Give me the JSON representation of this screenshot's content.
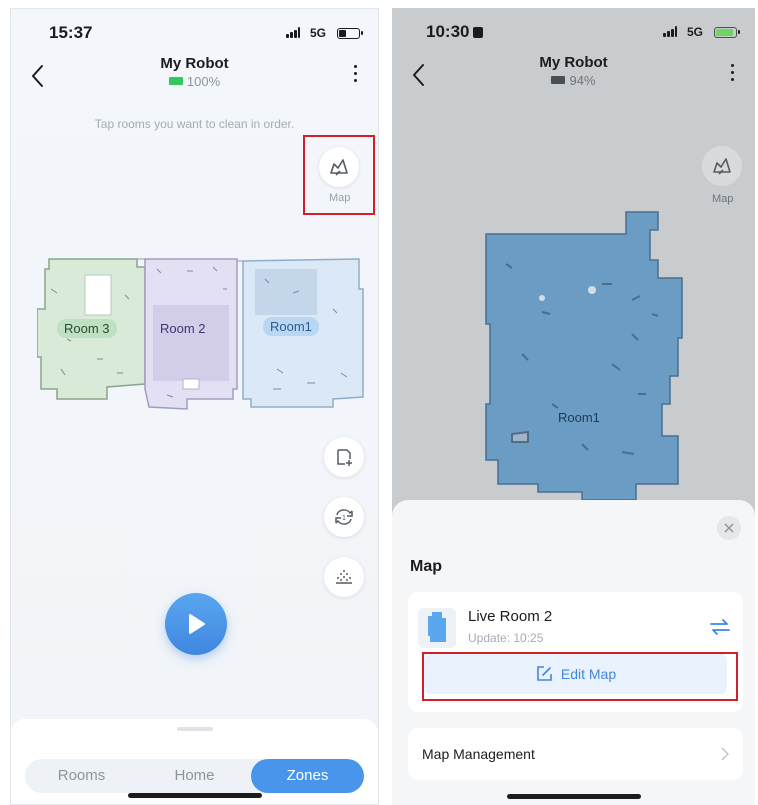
{
  "left": {
    "status": {
      "time": "15:37",
      "network": "5G"
    },
    "header": {
      "title": "My Robot",
      "battery": "100%"
    },
    "hint": "Tap rooms you want to clean in order.",
    "map_button_label": "Map",
    "rooms": [
      {
        "label": "Room 3"
      },
      {
        "label": "Room 2"
      },
      {
        "label": "Room1"
      }
    ],
    "modes": [
      {
        "label": "Rooms"
      },
      {
        "label": "Home"
      },
      {
        "label": "Zones",
        "selected": true
      }
    ],
    "icons": [
      "back-arrow-icon",
      "more-icon",
      "map-switch-icon",
      "add-zone-icon",
      "repeat-once-icon",
      "suction-icon",
      "play-icon"
    ]
  },
  "right": {
    "status": {
      "time": "10:30",
      "network": "5G",
      "charging": true
    },
    "header": {
      "title": "My Robot",
      "battery": "94%"
    },
    "map_button_label": "Map",
    "room_label": "Room1",
    "sheet": {
      "title": "Map",
      "live_map_name": "Live Room 2",
      "update_text": "Update: 10:25",
      "edit_button": "Edit Map",
      "management_label": "Map Management"
    },
    "icons": [
      "back-arrow-icon",
      "more-icon",
      "map-switch-icon",
      "close-icon",
      "swap-icon",
      "edit-icon",
      "chevron-right-icon"
    ]
  },
  "colors": {
    "accent": "#4a95ec",
    "highlight": "#d0202a",
    "battery_full": "#34c759",
    "room3_fill": "#d9ead9",
    "room2_fill": "#e3e0f4",
    "room1_fill": "#dbe8f5",
    "live_map_fill": "#6a9cc4"
  }
}
